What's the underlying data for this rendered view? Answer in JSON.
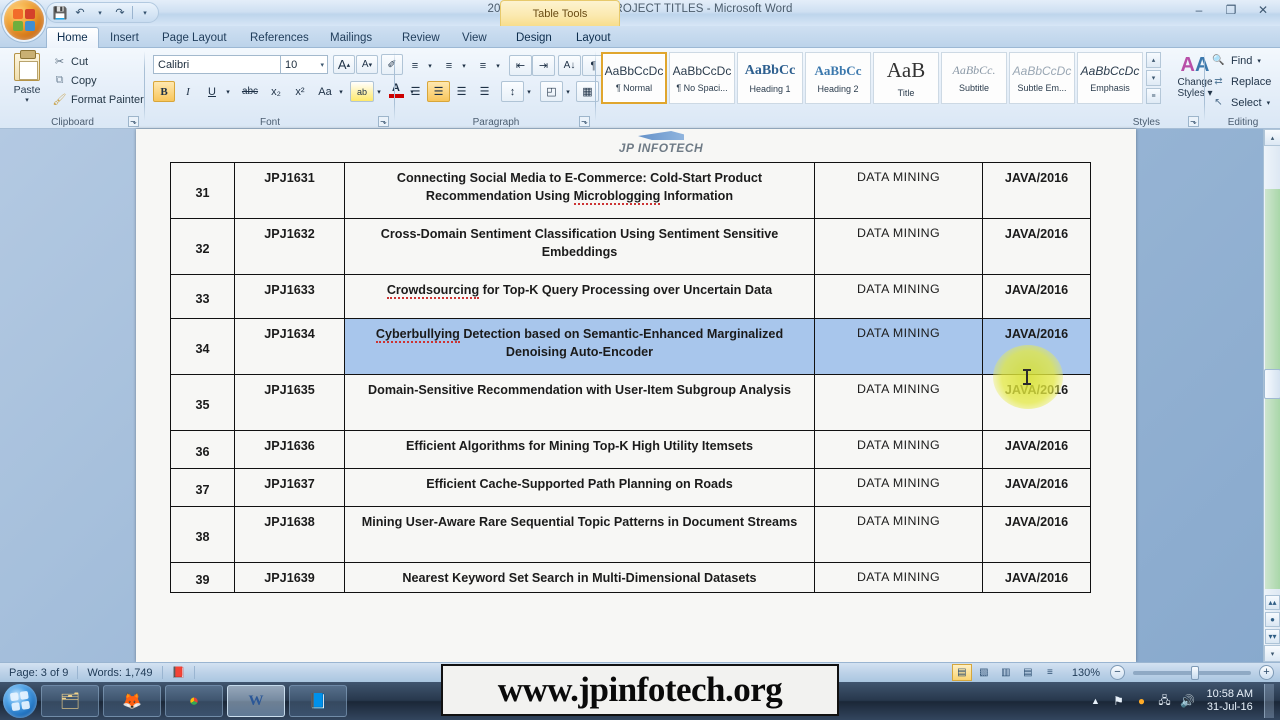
{
  "window": {
    "title": "2016-2017 IEEE JAVA PROJECT TITLES - Microsoft Word",
    "contextual_tab_group": "Table Tools",
    "minimize": "–",
    "restore": "❐",
    "close": "✕",
    "help": "?"
  },
  "quick_access": {
    "save": "💾",
    "undo": "↶",
    "redo": "↷",
    "customize": "▾"
  },
  "tabs": [
    {
      "label": "Home",
      "active": true
    },
    {
      "label": "Insert",
      "active": false
    },
    {
      "label": "Page Layout",
      "active": false
    },
    {
      "label": "References",
      "active": false
    },
    {
      "label": "Mailings",
      "active": false
    },
    {
      "label": "Review",
      "active": false
    },
    {
      "label": "View",
      "active": false
    },
    {
      "label": "Design",
      "active": false
    },
    {
      "label": "Layout",
      "active": false
    }
  ],
  "ribbon": {
    "clipboard": {
      "group_label": "Clipboard",
      "paste": "Paste",
      "paste_caret": "▾",
      "cut": "Cut",
      "copy": "Copy",
      "format_painter": "Format Painter",
      "cut_icon": "✂",
      "copy_icon": "⧉",
      "painter_icon": "🖌",
      "launcher": "⬎"
    },
    "font": {
      "group_label": "Font",
      "font_name": "Calibri",
      "font_size": "10",
      "grow_font": "A",
      "shrink_font": "A",
      "clear_formatting": "✐",
      "bold": "B",
      "italic": "I",
      "underline": "U",
      "strikethrough": "abc",
      "subscript": "x₂",
      "superscript": "x²",
      "change_case": "Aa",
      "highlight": "ab",
      "font_color": "A",
      "caret": "▾",
      "launcher": "⬎"
    },
    "paragraph": {
      "group_label": "Paragraph",
      "bullets": "≡",
      "numbering": "≡",
      "multilevel": "≡",
      "decrease_indent": "⇤",
      "increase_indent": "⇥",
      "sort": "A↓",
      "show_marks": "¶",
      "align_left": "☰",
      "align_center": "☰",
      "align_right": "☰",
      "justify": "☰",
      "line_spacing": "↕",
      "shading": "◰",
      "borders": "▦",
      "caret": "▾",
      "launcher": "⬎"
    },
    "styles": {
      "group_label": "Styles",
      "items": [
        {
          "preview": "AaBbCcDc",
          "name": "¶ Normal",
          "selected": true
        },
        {
          "preview": "AaBbCcDc",
          "name": "¶ No Spaci...",
          "selected": false
        },
        {
          "preview": "AaBbCс",
          "name": "Heading 1",
          "selected": false
        },
        {
          "preview": "AaBbCc",
          "name": "Heading 2",
          "selected": false
        },
        {
          "preview": "AaB",
          "name": "Title",
          "selected": false
        },
        {
          "preview": "AaBbCc.",
          "name": "Subtitle",
          "selected": false
        },
        {
          "preview": "AaBbCcDc",
          "name": "Subtle Em...",
          "selected": false
        },
        {
          "preview": "AaBbCcDc",
          "name": "Emphasis",
          "selected": false
        }
      ],
      "scroll_up": "▴",
      "scroll_down": "▾",
      "more": "≡",
      "change_styles_line1": "Change",
      "change_styles_line2": "Styles ▾",
      "change_styles_icon": "AA",
      "launcher": "⬎"
    },
    "editing": {
      "group_label": "Editing",
      "find": "Find",
      "find_caret": "▾",
      "replace": "Replace",
      "select": "Select",
      "select_caret": "▾",
      "find_icon": "🔍",
      "replace_icon": "⇄",
      "select_icon": "↖"
    }
  },
  "document": {
    "header_logo_text": "JP INFOTECH",
    "table": {
      "columns": [
        "sno",
        "code",
        "title",
        "domain",
        "language"
      ],
      "rows": [
        {
          "sno": "31",
          "code": "JPJ1631",
          "title_line1": "Connecting Social Media to E-Commerce: Cold-Start Product",
          "title_line2_pre": "Recommendation Using ",
          "title_line2_mis": "Microblogging",
          "title_line2_post": " Information",
          "domain": "DATA MINING",
          "language": "JAVA/2016",
          "selected": false
        },
        {
          "sno": "32",
          "code": "JPJ1632",
          "title_line1": "Cross-Domain Sentiment Classification  Using Sentiment Sensitive",
          "title_line2_pre": "Embeddings",
          "title_line2_mis": "",
          "title_line2_post": "",
          "domain": "DATA MINING",
          "language": "JAVA/2016",
          "selected": false
        },
        {
          "sno": "33",
          "code": "JPJ1633",
          "title_line1": "",
          "title_line2_pre": "",
          "title_line2_mis": "Crowdsourcing",
          "title_line2_post": " for Top-K Query Processing over Uncertain Data",
          "domain": "DATA MINING",
          "language": "JAVA/2016",
          "selected": false
        },
        {
          "sno": "34",
          "code": "JPJ1634",
          "title_line1": "",
          "title_line2_pre": "",
          "title_line2_mis": "Cyberbullying",
          "title_line2_post": " Detection based on Semantic-Enhanced Marginalized Denoising Auto-Encoder",
          "domain": "DATA MINING",
          "language": "JAVA/2016",
          "selected": true
        },
        {
          "sno": "35",
          "code": "JPJ1635",
          "title_line1": "Domain-Sensitive Recommendation  with User-Item Subgroup",
          "title_line2_pre": "Analysis",
          "title_line2_mis": "",
          "title_line2_post": "",
          "domain": "DATA MINING",
          "language": "JAVA/2016",
          "selected": false
        },
        {
          "sno": "36",
          "code": "JPJ1636",
          "title_line1": "Efficient Algorithms for Mining Top-K High Utility Itemsets",
          "title_line2_pre": "",
          "title_line2_mis": "",
          "title_line2_post": "",
          "domain": "DATA MINING",
          "language": "JAVA/2016",
          "selected": false
        },
        {
          "sno": "37",
          "code": "JPJ1637",
          "title_line1": "Efficient Cache-Supported  Path Planning  on Roads",
          "title_line2_pre": "",
          "title_line2_mis": "",
          "title_line2_post": "",
          "domain": "DATA MINING",
          "language": "JAVA/2016",
          "selected": false
        },
        {
          "sno": "38",
          "code": "JPJ1638",
          "title_line1": "Mining User-Aware  Rare Sequential Topic Patterns in Document",
          "title_line2_pre": "Streams",
          "title_line2_mis": "",
          "title_line2_post": "",
          "domain": "DATA MINING",
          "language": "JAVA/2016",
          "selected": false
        },
        {
          "sno": "39",
          "code": "JPJ1639",
          "title_line1": "Nearest Keyword Set Search in Multi-Dimensional  Datasets",
          "title_line2_pre": "",
          "title_line2_mis": "",
          "title_line2_post": "",
          "domain": "DATA MINING",
          "language": "JAVA/2016",
          "selected": false
        }
      ]
    }
  },
  "scrollbar": {
    "up_arrow": "▴",
    "down_arrow": "▾",
    "prev_page": "▴▴",
    "select_object": "●",
    "next_page": "▾▾",
    "split": "▔"
  },
  "statusbar": {
    "page": "Page: 3 of 9",
    "words": "Words: 1,749",
    "proofing_icon": "📕",
    "view_print": "▤",
    "view_fullscreen": "▧",
    "view_web": "▥",
    "view_outline": "▤",
    "view_draft": "≡",
    "zoom_level": "130%",
    "zoom_out": "−",
    "zoom_in": "+"
  },
  "taskbar": {
    "start": "start-orb",
    "buttons": [
      {
        "name": "explorer",
        "icon": "🗂",
        "active": false
      },
      {
        "name": "firefox",
        "icon": "🦊",
        "active": false
      },
      {
        "name": "chrome",
        "icon": "●",
        "active": false
      },
      {
        "name": "word",
        "icon": "W",
        "active": true
      },
      {
        "name": "notes",
        "icon": "📘",
        "active": false
      }
    ],
    "tray": {
      "show_hidden": "▲",
      "network": "⚑",
      "update": "●",
      "volume": "🔊",
      "time": "10:58 AM",
      "date": "31-Jul-16"
    }
  },
  "overlay": {
    "watermark": "www.jpinfotech.org"
  }
}
